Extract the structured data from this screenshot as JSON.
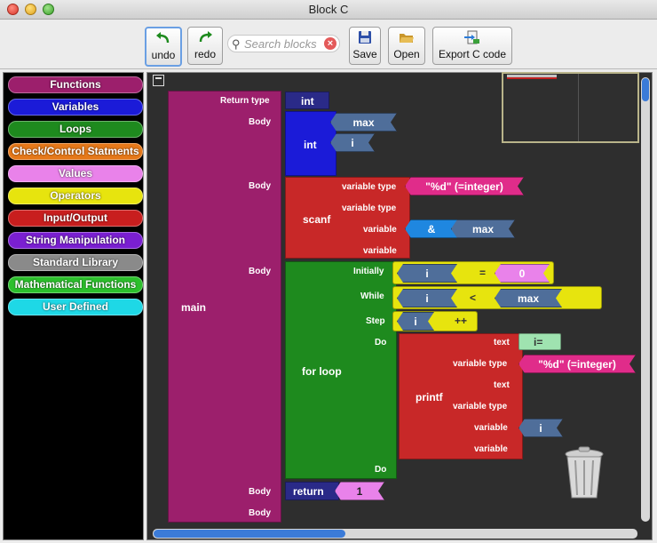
{
  "window": {
    "title": "Block C"
  },
  "toolbar": {
    "undo": "undo",
    "redo": "redo",
    "search_placeholder": "Search blocks",
    "save": "Save",
    "open": "Open",
    "export": "Export C code"
  },
  "sidebar": {
    "categories": [
      {
        "label": "Functions",
        "color": "#9c1f6c"
      },
      {
        "label": "Variables",
        "color": "#1b1bd8"
      },
      {
        "label": "Loops",
        "color": "#1e8a1e"
      },
      {
        "label": "Check/Control Statments",
        "color": "#e6791a"
      },
      {
        "label": "Values",
        "color": "#e982ea"
      },
      {
        "label": "Operators",
        "color": "#e7e40e"
      },
      {
        "label": "Input/Output",
        "color": "#c81e1e"
      },
      {
        "label": "String Manipulation",
        "color": "#7a1fd1"
      },
      {
        "label": "Standard Library",
        "color": "#8a8a8a"
      },
      {
        "label": "Mathematical Functions",
        "color": "#2cc02c"
      },
      {
        "label": "User Defined",
        "color": "#1ed8e6"
      }
    ]
  },
  "canvas": {
    "main": {
      "name": "main",
      "return_type_label": "Return type",
      "return_type": "int",
      "body_label": "Body"
    },
    "decl": {
      "type": "int",
      "var1": "max",
      "var2": "i"
    },
    "scanf": {
      "name": "scanf",
      "lbl_vartype": "variable type",
      "lbl_vartype2": "variable type",
      "lbl_var": "variable",
      "lbl_var2": "variable",
      "format": "\"%d\" (=integer)",
      "amp": "&",
      "var": "max"
    },
    "forloop": {
      "name": "for loop",
      "initially": "Initially",
      "while": "While",
      "step": "Step",
      "do": "Do",
      "do_end": "Do",
      "init_var": "i",
      "init_op": "=",
      "init_val": "0",
      "cond_var": "i",
      "cond_op": "<",
      "cond_val": "max",
      "step_var": "i",
      "step_op": "++"
    },
    "printf": {
      "name": "printf",
      "lbl_text": "text",
      "lbl_vartype": "variable type",
      "lbl_text2": "text",
      "lbl_vartype2": "variable type",
      "lbl_var": "variable",
      "lbl_var2": "variable",
      "text": "i=",
      "format": "\"%d\" (=integer)",
      "var": "i"
    },
    "ret": {
      "name": "return",
      "value": "1",
      "body_label": "Body",
      "body_label2": "Body"
    }
  }
}
